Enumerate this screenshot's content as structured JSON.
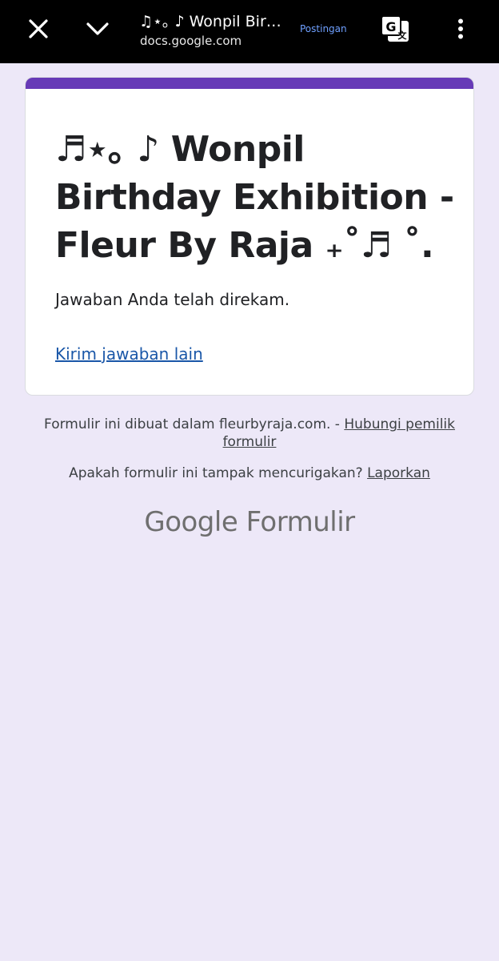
{
  "topbar": {
    "title": "♫⋆｡ ♪ Wonpil Birth...",
    "url": "docs.google.com",
    "post_label": "Postingan",
    "icons": {
      "close": "close-icon",
      "collapse": "chevron-down-icon",
      "translate": "translate-icon",
      "more": "more-vert-icon"
    }
  },
  "card": {
    "accent_color": "#673ab7",
    "title": "♬⋆｡ ♪ Wonpil Birthday Exhibition - Fleur By Raja ₊˚♬ ˚.",
    "confirmation": "Jawaban Anda telah direkam.",
    "another_response_link": "Kirim jawaban lain"
  },
  "footer": {
    "made_in_text": "Formulir ini dibuat dalam fleurbyraja.com. - ",
    "contact_owner_link": "Hubungi pemilik formulir",
    "suspicious_text": "Apakah formulir ini tampak mencurigakan? ",
    "report_link": "Laporkan",
    "brand_google": "Google",
    "brand_product": "Formulir"
  }
}
